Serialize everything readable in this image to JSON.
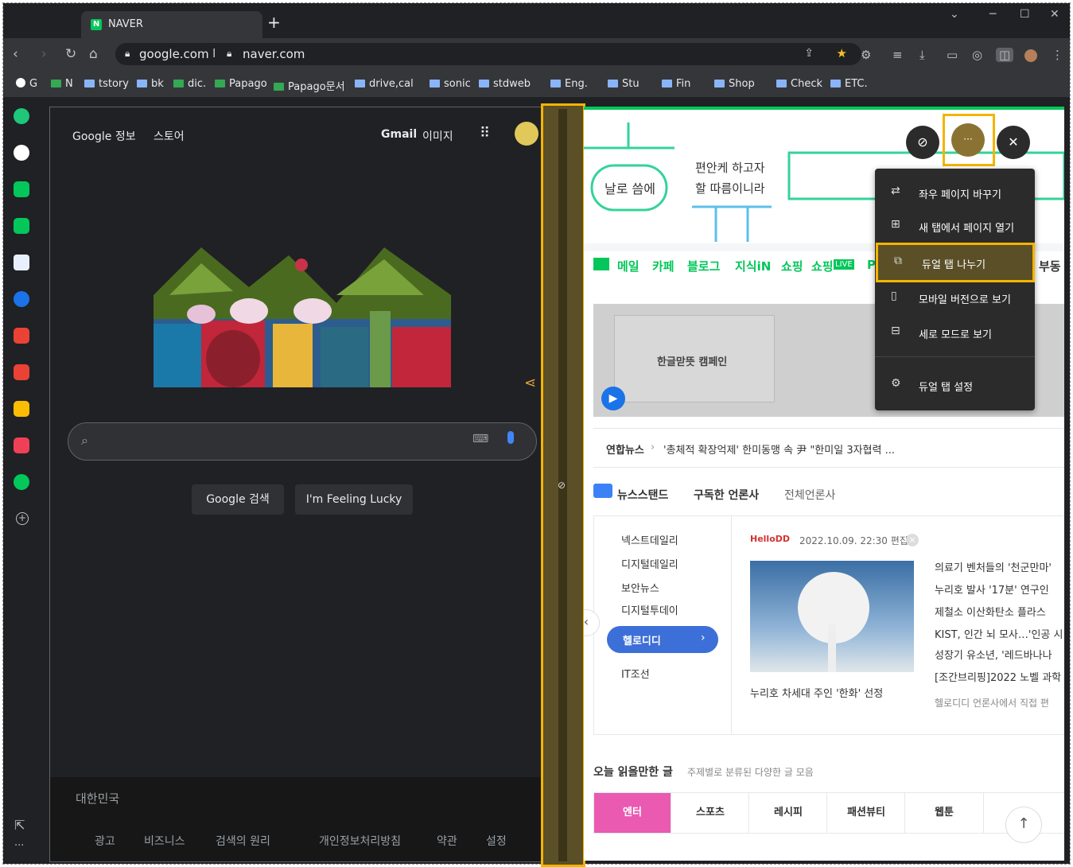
{
  "browser": {
    "tab_title": "NAVER",
    "tab_favicon": "N",
    "new_tab": "+",
    "url_left": "google.com",
    "url_sep": "I",
    "url_right": "naver.com"
  },
  "bookmarks": [
    {
      "label": "G",
      "icon": "google-icon"
    },
    {
      "label": "N",
      "icon": "naver-icon"
    },
    {
      "label": "tstory",
      "icon": "folder-icon"
    },
    {
      "label": "bk",
      "icon": "folder-icon"
    },
    {
      "label": "dic.",
      "icon": "dictionary-icon"
    },
    {
      "label": "Papago",
      "icon": "papago-icon"
    },
    {
      "label": "Papago문서",
      "icon": "papago-icon"
    },
    {
      "label": "drive,cal",
      "icon": "folder-icon"
    },
    {
      "label": "sonic",
      "icon": "folder-icon"
    },
    {
      "label": "stdweb",
      "icon": "folder-icon"
    },
    {
      "label": "Eng.",
      "icon": "folder-icon"
    },
    {
      "label": "Stu",
      "icon": "folder-icon"
    },
    {
      "label": "Fin",
      "icon": "folder-icon"
    },
    {
      "label": "Shop",
      "icon": "folder-icon"
    },
    {
      "label": "Check",
      "icon": "folder-icon"
    },
    {
      "label": "ETC.",
      "icon": "folder-icon"
    }
  ],
  "sidebar": {
    "more": "···"
  },
  "google": {
    "about": "Google 정보",
    "store": "스토어",
    "gmail": "Gmail",
    "images": "이미지",
    "search_btn": "Google 검색",
    "lucky_btn": "I'm Feeling Lucky",
    "country": "대한민국",
    "footer": [
      "광고",
      "비즈니스",
      "검색의 원리",
      "개인정보처리방침",
      "약관",
      "설정"
    ]
  },
  "naver": {
    "banner_left": "날로 씀에",
    "banner_mid1": "편안케 하고자",
    "banner_mid2": "할 따름이니라",
    "nav": [
      "메일",
      "카페",
      "블로그",
      "지식iN",
      "쇼핑",
      "쇼핑",
      "Pa",
      "부동"
    ],
    "live_badge": "LIVE",
    "ad_text": "한글맏뜻 캠페인",
    "news_source": "연합뉴스",
    "news_headline": "'총체적 확장억제' 한미동맹 속 尹 \"한미일 3자협력 ...",
    "newsstand": "뉴스스탠드",
    "subscribed": "구독한 언론사",
    "all_press": "전체언론사",
    "press_list": [
      "넥스트데일리",
      "디지털데일리",
      "보안뉴스",
      "디지털투데이",
      "헬로디디",
      "IT조선"
    ],
    "press_logo": "HelloDD",
    "press_time": "2022.10.09. 22:30 편집",
    "photo_caption": "누리호 차세대 주인 '한화' 선정",
    "headlines": [
      "의료기 벤처들의 '천군만마'",
      "누리호 발사 '17분' 연구인",
      "제철소 이산화탄소 플라스",
      "KIST, 인간 뇌 모사…'인공 시",
      "성장기 유소년, '레드바나나",
      "[조간브리핑]2022 노벨 과학"
    ],
    "press_note": "헬로디디 언론사에서 직접 편",
    "reading_title": "오늘 읽을만한 글",
    "reading_sub": "주제별로 분류된 다양한 글 모음",
    "reading_tabs": [
      "엔터",
      "스포츠",
      "레시피",
      "패션뷰티",
      "웹툰"
    ]
  },
  "dual_menu": {
    "more_btn": "···",
    "items": [
      {
        "label": "좌우 페이지 바꾸기",
        "icon": "swap-icon"
      },
      {
        "label": "새 탭에서 페이지 열기",
        "icon": "new-tab-icon"
      },
      {
        "label": "듀얼 탭 나누기",
        "icon": "split-icon"
      },
      {
        "label": "모바일 버전으로 보기",
        "icon": "mobile-icon"
      },
      {
        "label": "세로 모드로 보기",
        "icon": "vertical-icon"
      },
      {
        "label": "듀얼 탭 설정",
        "icon": "gear-icon"
      }
    ]
  },
  "colors": {
    "highlight": "#f4b400",
    "naver_green": "#03c75a",
    "pink_tab": "#e95ab0"
  }
}
